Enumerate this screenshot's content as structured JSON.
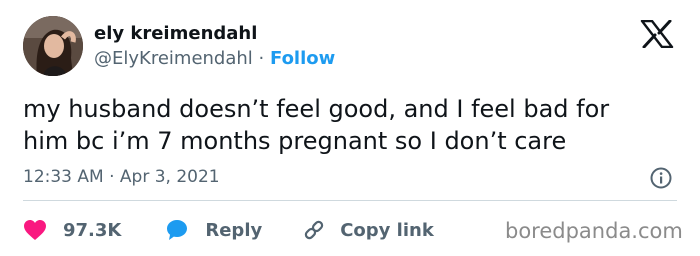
{
  "author": {
    "name": "ely kreimendahl",
    "handle": "@ElyKreimendahl",
    "separator": "·",
    "follow_label": "Follow"
  },
  "tweet": {
    "lines": [
      "my husband doesn’t feel good, and I feel bad for",
      "him bc i’m 7 months pregnant so I don’t care"
    ],
    "time": "12:33 AM",
    "separator": "·",
    "date": "Apr 3, 2021"
  },
  "actions": {
    "likes": "97.3K",
    "reply_label": "Reply",
    "copy_link_label": "Copy link"
  },
  "watermark": "boredpanda.com",
  "icons": {
    "platform": "x-logo-icon",
    "info": "info-icon",
    "like": "heart-icon",
    "reply": "speech-bubble-icon",
    "copy": "link-icon"
  },
  "colors": {
    "text": "#0f1419",
    "muted": "#536471",
    "link": "#1d9bf0",
    "like": "#f91880",
    "watermark": "#8b8b8b"
  }
}
